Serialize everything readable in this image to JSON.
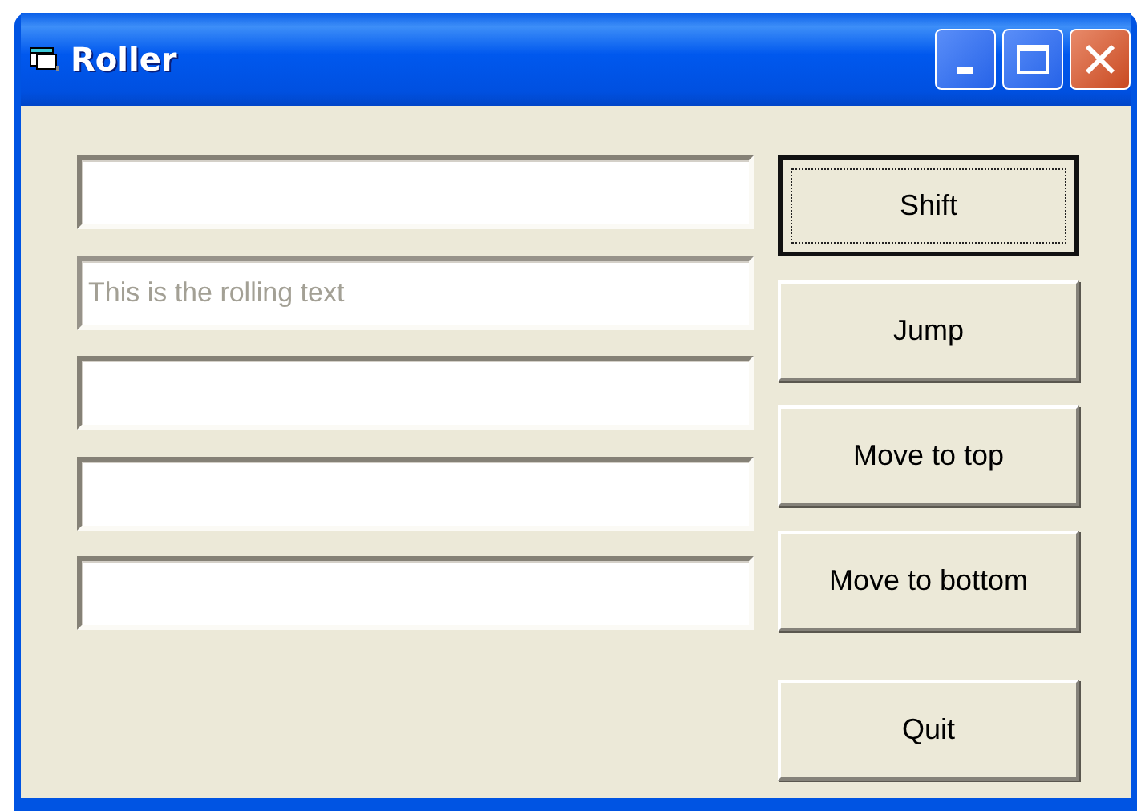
{
  "window": {
    "title": "Roller"
  },
  "fields": [
    {
      "disabled": false
    },
    {
      "value": "This is the rolling text",
      "disabled": true
    },
    {
      "disabled": false
    },
    {
      "disabled": false
    },
    {
      "disabled": false
    }
  ],
  "buttons": [
    {
      "label": "Shift",
      "focused": true
    },
    {
      "label": "Jump",
      "focused": false
    },
    {
      "label": "Move to top",
      "focused": false
    },
    {
      "label": "Move to bottom",
      "focused": false
    },
    {
      "label": "Quit",
      "focused": false
    }
  ]
}
